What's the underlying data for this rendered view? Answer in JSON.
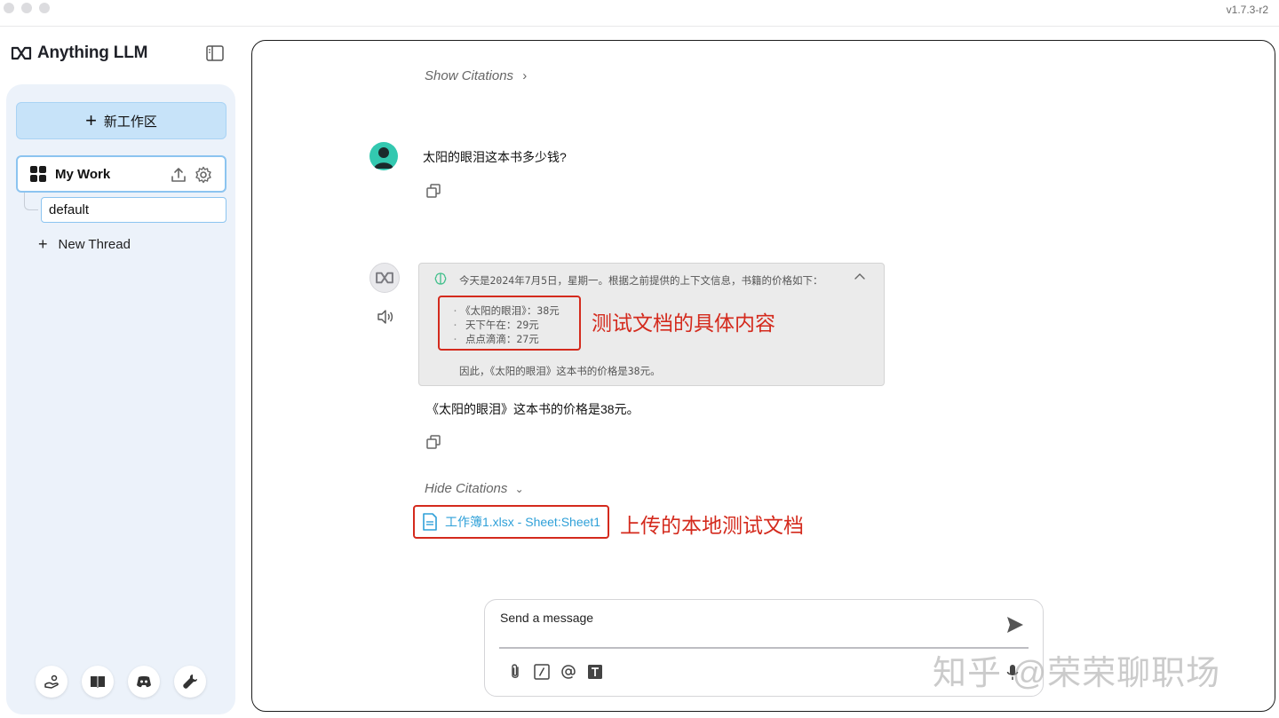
{
  "window": {
    "version": "v1.7.3-r2"
  },
  "sidebar": {
    "brand": "Anything LLM",
    "new_workspace_label": "新工作区",
    "workspace": {
      "name": "My Work",
      "thread": "default"
    },
    "new_thread_label": "New Thread",
    "footer_icons": [
      "community-icon",
      "docs-icon",
      "discord-icon",
      "settings-wrench-icon"
    ]
  },
  "chat": {
    "show_citations": "Show Citations",
    "user_message": "太阳的眼泪这本书多少钱?",
    "thinking": {
      "header": "今天是2024年7月5日，星期一。根据之前提供的上下文信息，书籍的价格如下：",
      "items": [
        "《太阳的眼泪》：38元",
        "天下午在：29元",
        "点点滴滴：27元"
      ],
      "conclusion": "因此，《太阳的眼泪》这本书的价格是38元。"
    },
    "annotation_content": "测试文档的具体内容",
    "assistant_message": "《太阳的眼泪》这本书的价格是38元。",
    "hide_citations": "Hide Citations",
    "citation_file": "工作簿1.xlsx - Sheet:Sheet1",
    "annotation_document": "上传的本地测试文档"
  },
  "composer": {
    "placeholder": "Send a message"
  },
  "watermark": "知乎 @荣荣聊职场",
  "colors": {
    "accent_blue": "#c7e3f9",
    "annotation_red": "#d42a1d",
    "citation_link": "#2fa0d8"
  }
}
